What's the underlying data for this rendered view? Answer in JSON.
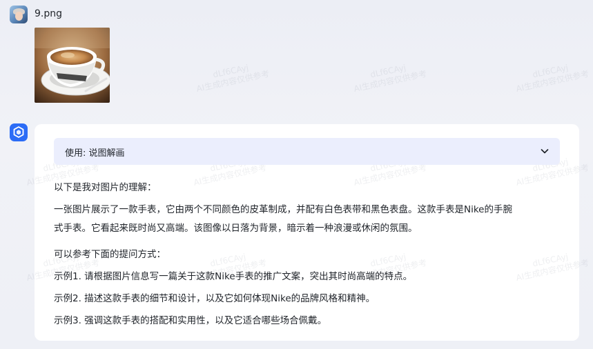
{
  "user_message": {
    "file_name": "9.png"
  },
  "assistant_message": {
    "tool_label": "使用: 说图解画",
    "intro": "以下是我对图片的理解：",
    "description_line1": "一张图片展示了一款手表，它由两个不同颜色的皮革制成，并配有白色表带和黑色表盘。这款手表是Nike的手腕",
    "description_line2": "式手表。它看起来既时尚又高端。该图像以日落为背景，暗示着一种浪漫或休闲的氛围。",
    "suggestions_heading": "可以参考下面的提问方式：",
    "examples": [
      "示例1. 请根据图片信息写一篇关于这款Nike手表的推广文案，突出其时尚高端的特点。",
      "示例2. 描述这款手表的细节和设计，以及它如何体现Nike的品牌风格和精神。",
      "示例3. 强调这款手表的搭配和实用性，以及它适合哪些场合佩戴。"
    ]
  },
  "watermark": {
    "line1": "dLf6CAyj",
    "line2": "AI生成内容仅供参考"
  },
  "colors": {
    "accent": "#2b6cf6",
    "tool_bar_bg": "#ebeefd",
    "card_bg": "#ffffff"
  },
  "icons": {
    "user_avatar": "user-avatar-photo",
    "bot_avatar": "hexagon-cube-icon",
    "expand": "chevron-down-icon"
  }
}
